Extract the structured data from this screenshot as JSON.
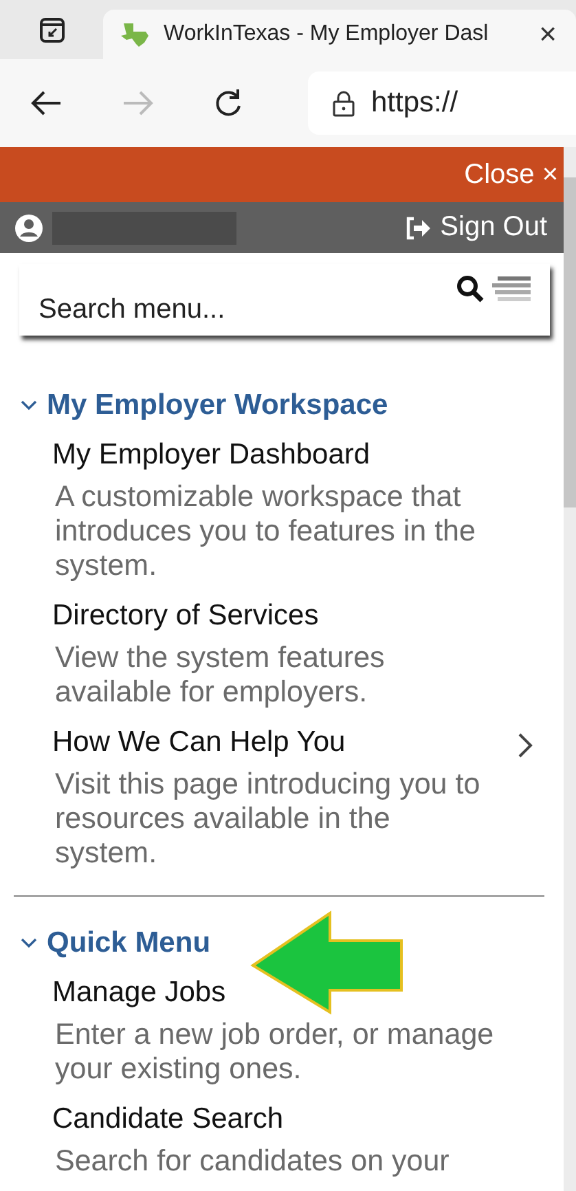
{
  "browser": {
    "tab_title": "WorkInTexas - My Employer Dasl",
    "close_tab": "×",
    "url": "https://"
  },
  "panel": {
    "close": "Close ×",
    "sign_out": "Sign Out",
    "search": {
      "placeholder": "Search menu..."
    }
  },
  "sections": [
    {
      "title": "My Employer Workspace",
      "expanded": true,
      "items": [
        {
          "title": "My Employer Dashboard",
          "description": "A customizable workspace that introduces you to features in the system.",
          "has_submenu": false
        },
        {
          "title": "Directory of Services",
          "description": "View the system features available for employers.",
          "has_submenu": false
        },
        {
          "title": "How We Can Help You",
          "description": "Visit this page introducing you to resources available in the system.",
          "has_submenu": true
        }
      ]
    },
    {
      "title": "Quick Menu",
      "expanded": true,
      "items": [
        {
          "title": "Manage Jobs",
          "description": "Enter a new job order, or manage your existing ones.",
          "has_submenu": false,
          "annotated": true
        },
        {
          "title": "Candidate Search",
          "description": "Search for candidates on your",
          "has_submenu": false
        }
      ]
    }
  ]
}
